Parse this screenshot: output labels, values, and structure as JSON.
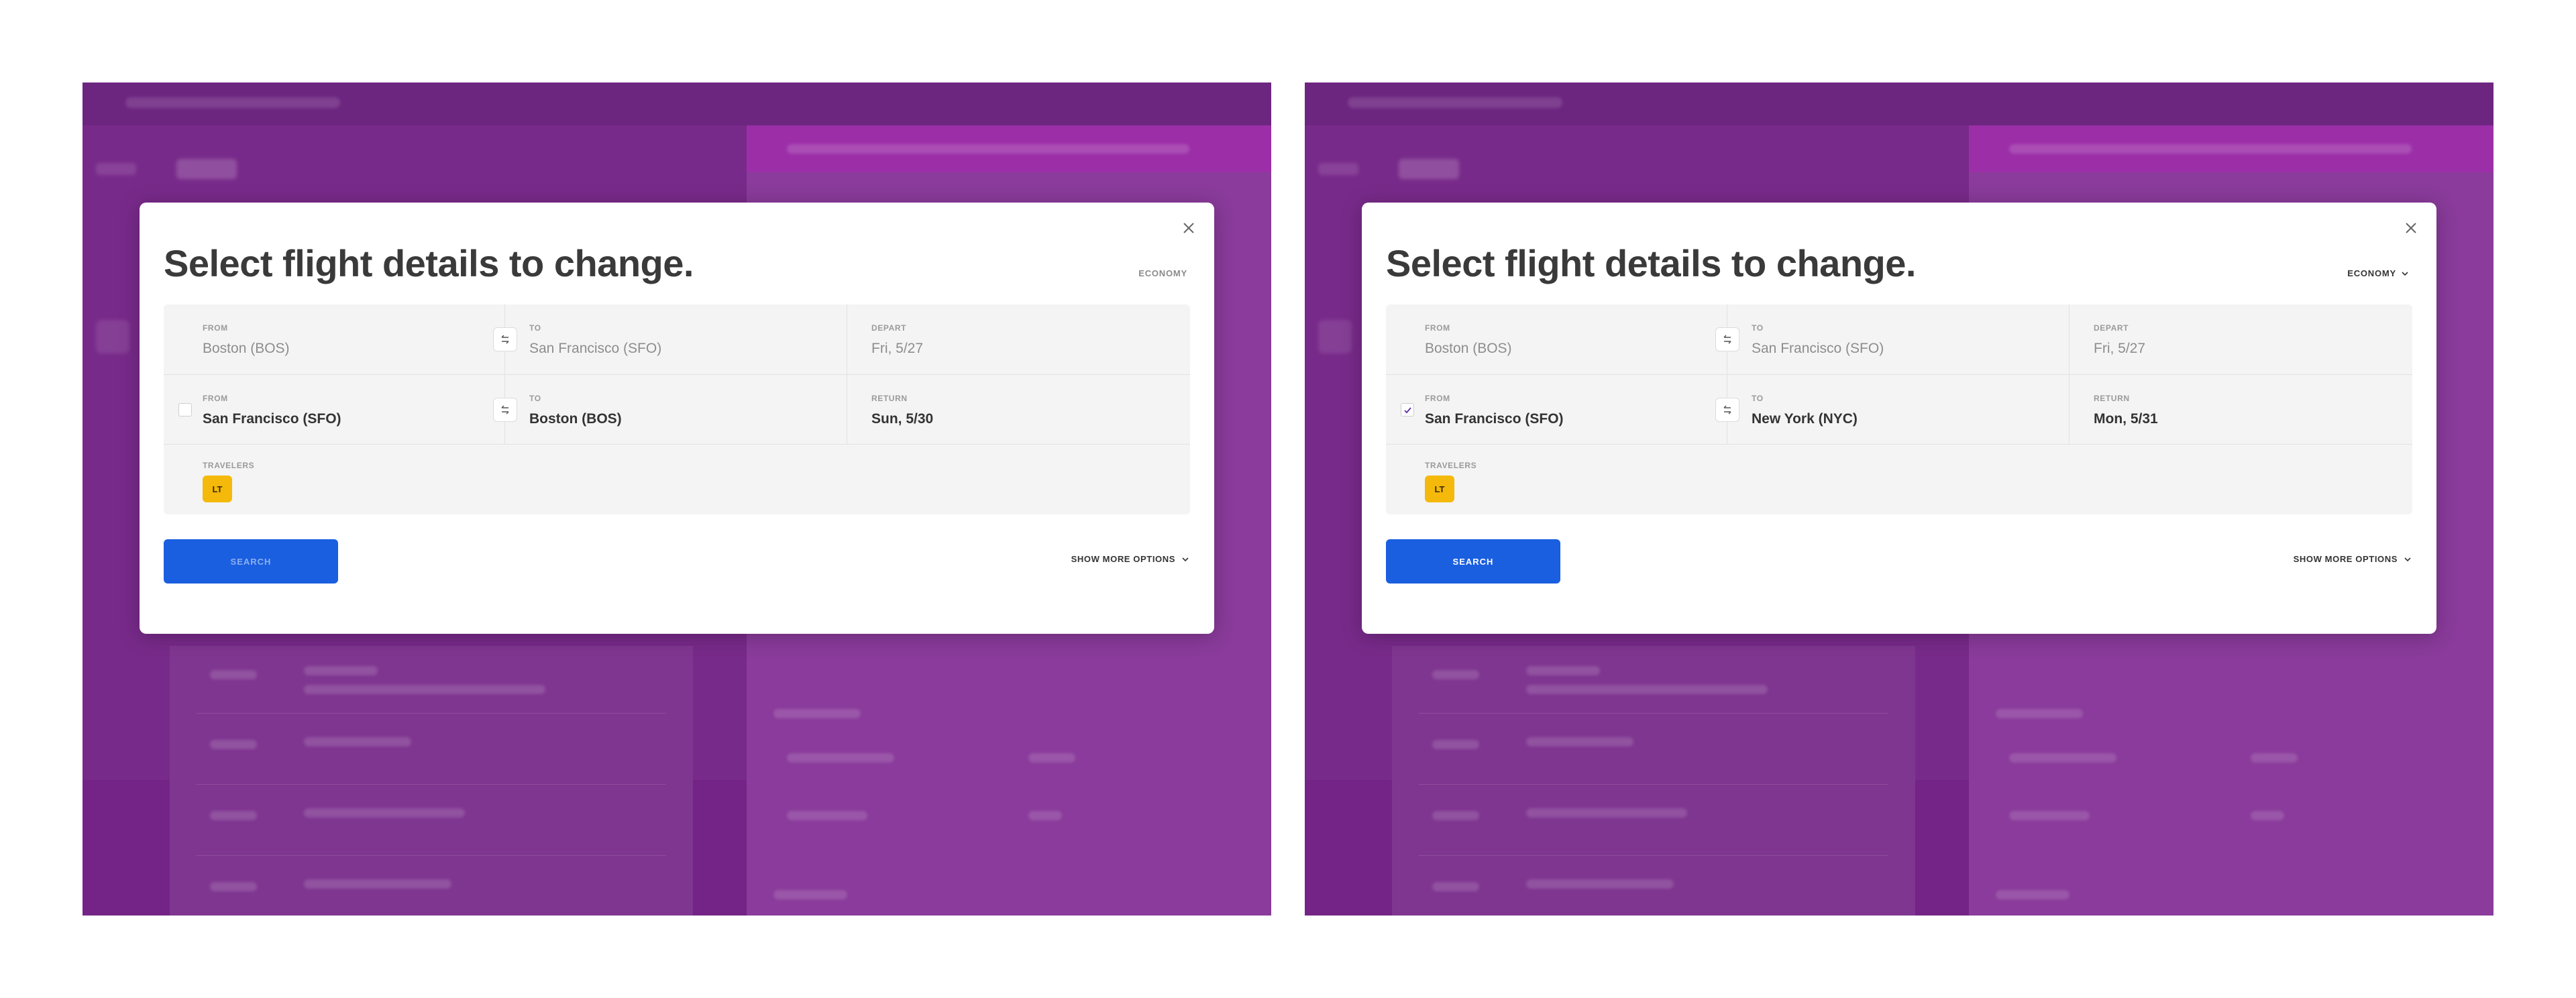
{
  "colors": {
    "overlay": "#7a2e8c",
    "primary_button": "#1a5fe0",
    "traveler_badge": "#f5b90b",
    "form_background": "#f4f4f4"
  },
  "screens": [
    {
      "state": "before-selection",
      "modal": {
        "title": "Select flight details to change.",
        "cabin": "ECONOMY",
        "close_icon": "close-icon",
        "legs": [
          {
            "from_label": "FROM",
            "from_value": "Boston (BOS)",
            "to_label": "TO",
            "to_value": "San Francisco (SFO)",
            "date_label": "DEPART",
            "date_value": "Fri, 5/27"
          },
          {
            "checked": false,
            "from_label": "FROM",
            "from_value": "San Francisco (SFO)",
            "to_label": "TO",
            "to_value": "Boston (BOS)",
            "date_label": "RETURN",
            "date_value": "Sun, 5/30"
          }
        ],
        "travelers_label": "TRAVELERS",
        "traveler_initials": "LT",
        "search_label": "SEARCH",
        "more_options_label": "SHOW MORE OPTIONS"
      }
    },
    {
      "state": "after-selection",
      "modal": {
        "title": "Select flight details to change.",
        "cabin": "ECONOMY",
        "close_icon": "close-icon",
        "legs": [
          {
            "from_label": "FROM",
            "from_value": "Boston (BOS)",
            "to_label": "TO",
            "to_value": "San Francisco (SFO)",
            "date_label": "DEPART",
            "date_value": "Fri, 5/27"
          },
          {
            "checked": true,
            "from_label": "FROM",
            "from_value": "San Francisco (SFO)",
            "to_label": "TO",
            "to_value": "New York (NYC)",
            "date_label": "RETURN",
            "date_value": "Mon, 5/31"
          }
        ],
        "travelers_label": "TRAVELERS",
        "traveler_initials": "LT",
        "search_label": "SEARCH",
        "more_options_label": "SHOW MORE OPTIONS"
      }
    }
  ]
}
